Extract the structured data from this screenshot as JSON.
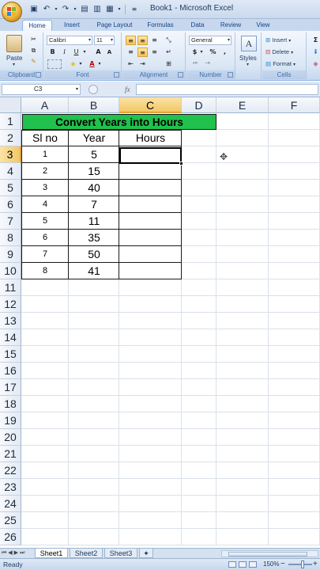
{
  "app": {
    "title": "Book1 - Microsoft Excel"
  },
  "ribbon_tabs": [
    "Home",
    "Insert",
    "Page Layout",
    "Formulas",
    "Data",
    "Review",
    "View"
  ],
  "ribbon": {
    "font_name": "Calibri",
    "font_size": "11",
    "number_format": "General",
    "bold": "B",
    "italic": "I",
    "underline": "U",
    "grow_font": "A",
    "shrink_font": "A",
    "currency": "$",
    "percent": "%",
    "comma": ",",
    "paste": "Paste",
    "styles": "Styles",
    "insert": "Insert",
    "delete": "Delete",
    "format": "Format",
    "groups": [
      "Clipboard",
      "Font",
      "Alignment",
      "Number",
      "Cells"
    ]
  },
  "formula_bar": {
    "name_box": "C3",
    "fx": "fx",
    "formula": ""
  },
  "grid": {
    "columns": [
      "A",
      "B",
      "C",
      "D",
      "E",
      "F"
    ],
    "selected_column": "C",
    "rows": [
      "1",
      "2",
      "3",
      "4",
      "5",
      "6",
      "7",
      "8",
      "9",
      "10",
      "11",
      "12",
      "13",
      "14",
      "15",
      "16",
      "17",
      "18",
      "19",
      "20",
      "21",
      "22",
      "23",
      "24",
      "25",
      "26"
    ],
    "selected_row": "3",
    "active_cell": "C3"
  },
  "table": {
    "title": "Convert Years into Hours",
    "title_fill": "#21c14d",
    "headers": [
      "Sl no",
      "Year",
      "Hours"
    ],
    "rows": [
      {
        "sl": "1",
        "year": "5",
        "hours": ""
      },
      {
        "sl": "2",
        "year": "15",
        "hours": ""
      },
      {
        "sl": "3",
        "year": "40",
        "hours": ""
      },
      {
        "sl": "4",
        "year": "7",
        "hours": ""
      },
      {
        "sl": "5",
        "year": "11",
        "hours": ""
      },
      {
        "sl": "6",
        "year": "35",
        "hours": ""
      },
      {
        "sl": "7",
        "year": "50",
        "hours": ""
      },
      {
        "sl": "8",
        "year": "41",
        "hours": ""
      }
    ]
  },
  "sheets": {
    "tabs": [
      "Sheet1",
      "Sheet2",
      "Sheet3"
    ],
    "active": "Sheet1"
  },
  "status": {
    "text": "Ready",
    "zoom": "150%",
    "zoom_minus": "−",
    "zoom_plus": "+"
  }
}
